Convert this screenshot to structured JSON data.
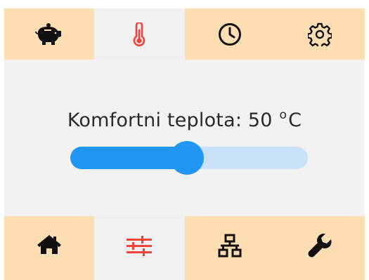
{
  "top_nav": {
    "items": [
      {
        "name": "savings",
        "icon": "piggy-bank-icon",
        "active": false
      },
      {
        "name": "temperature",
        "icon": "thermometer-icon",
        "active": true
      },
      {
        "name": "schedule",
        "icon": "clock-icon",
        "active": false
      },
      {
        "name": "settings",
        "icon": "gear-icon",
        "active": false
      }
    ]
  },
  "bottom_nav": {
    "items": [
      {
        "name": "home",
        "icon": "home-icon",
        "active": false
      },
      {
        "name": "controls",
        "icon": "sliders-icon",
        "active": true
      },
      {
        "name": "network",
        "icon": "network-icon",
        "active": false
      },
      {
        "name": "service",
        "icon": "wrench-icon",
        "active": false
      }
    ]
  },
  "main": {
    "label_text": "Komfortni teplota: 50",
    "degree_symbol": "o",
    "unit_letter": "C",
    "slider": {
      "value_fraction": 0.49
    }
  },
  "colors": {
    "bar_background": "#fddeb3",
    "active_tab_background": "#f0f0f0",
    "icon_default": "#111111",
    "icon_active": "#f0443a",
    "slider_fill": "#2196f3",
    "slider_track": "#c9e1f6"
  }
}
